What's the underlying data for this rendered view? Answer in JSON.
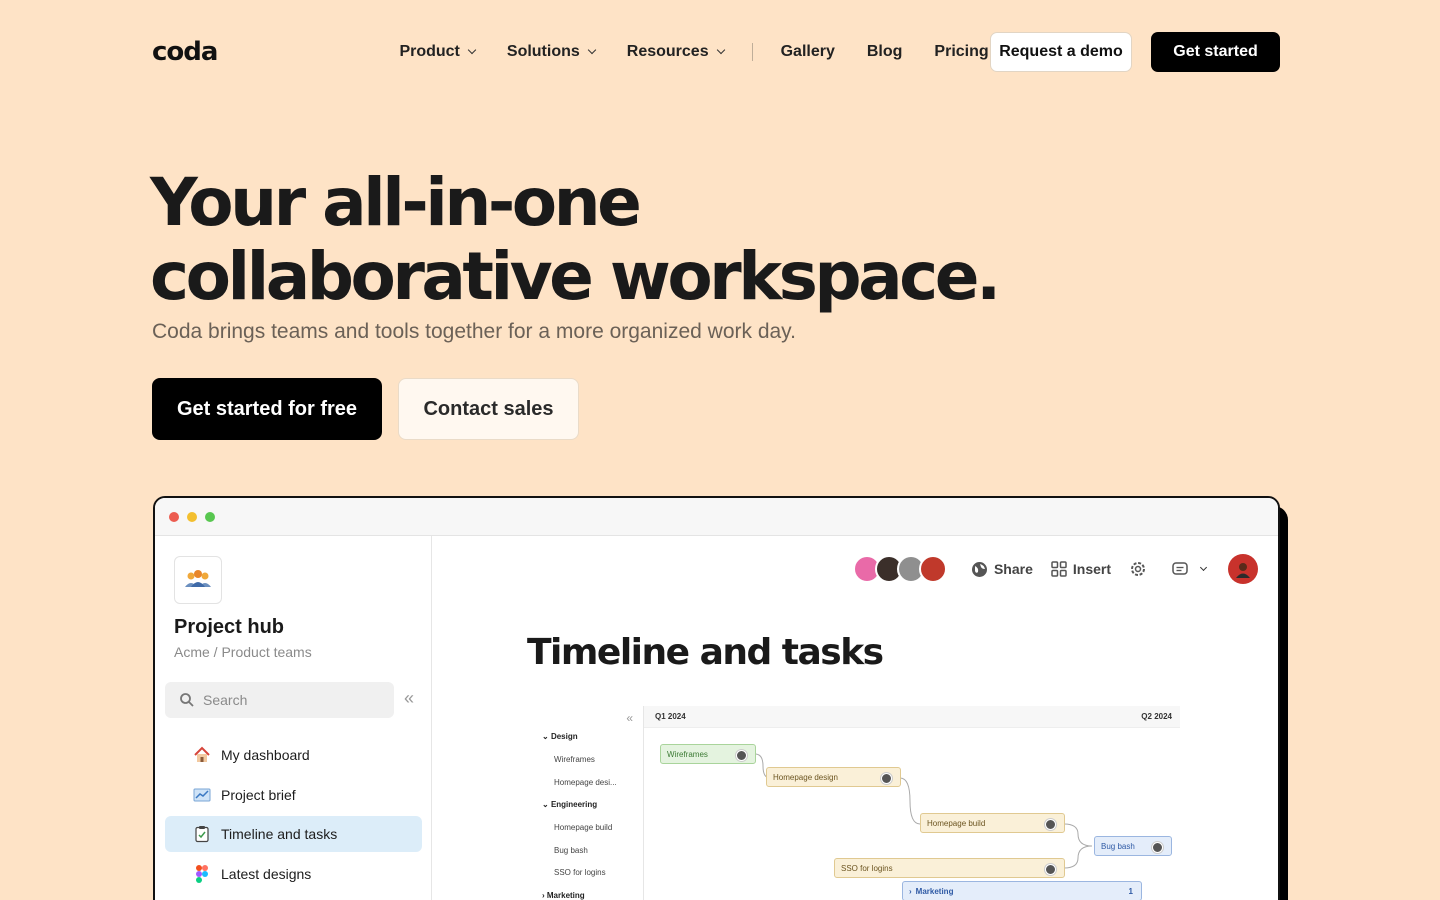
{
  "nav": {
    "logo": "coda",
    "items": [
      {
        "label": "Product",
        "dropdown": true
      },
      {
        "label": "Solutions",
        "dropdown": true
      },
      {
        "label": "Resources",
        "dropdown": true
      },
      {
        "label": "Gallery"
      },
      {
        "label": "Blog"
      },
      {
        "label": "Pricing"
      }
    ],
    "demo_label": "Request a demo",
    "start_label": "Get started"
  },
  "hero": {
    "title_line1": "Your all-in-one",
    "title_line2": "collaborative workspace.",
    "subtitle": "Coda brings teams and tools together for a more organized work day.",
    "cta_primary": "Get started for free",
    "cta_secondary": "Contact sales"
  },
  "app": {
    "traffic_colors": [
      "#ec5c50",
      "#f3bf2f",
      "#58c750"
    ],
    "sidebar": {
      "title": "Project hub",
      "breadcrumb": "Acme / Product teams",
      "search_placeholder": "Search",
      "items": [
        {
          "label": "My dashboard",
          "icon": "house-icon"
        },
        {
          "label": "Project brief",
          "icon": "chart-icon"
        },
        {
          "label": "Timeline and tasks",
          "icon": "clipboard-icon",
          "active": true
        },
        {
          "label": "Latest designs",
          "icon": "figma-icon"
        }
      ]
    },
    "toolbar": {
      "share": "Share",
      "insert": "Insert"
    },
    "doc_title": "Timeline and tasks",
    "timeline": {
      "quarters": [
        "Q1 2024",
        "Q2 2024"
      ],
      "rows": [
        {
          "label": "Design",
          "group": true
        },
        {
          "label": "Wireframes"
        },
        {
          "label": "Homepage desi..."
        },
        {
          "label": "Engineering",
          "group": true
        },
        {
          "label": "Homepage build"
        },
        {
          "label": "Bug bash"
        },
        {
          "label": "SSO for logins"
        },
        {
          "label": "Marketing",
          "group": true
        }
      ],
      "bars": [
        {
          "label": "Wireframes",
          "status": "done",
          "color": "#e4f3df"
        },
        {
          "label": "Homepage design",
          "status": "in-progress",
          "color": "#faf0d8"
        },
        {
          "label": "Homepage build",
          "status": "in-progress",
          "color": "#faf0d8"
        },
        {
          "label": "Bug bash",
          "status": "planned",
          "color": "#e4edfa"
        },
        {
          "label": "SSO for logins",
          "status": "in-progress",
          "color": "#faf0d8"
        },
        {
          "label": "Marketing",
          "status": "group",
          "color": "#e4edfa",
          "count": "1"
        }
      ]
    }
  }
}
